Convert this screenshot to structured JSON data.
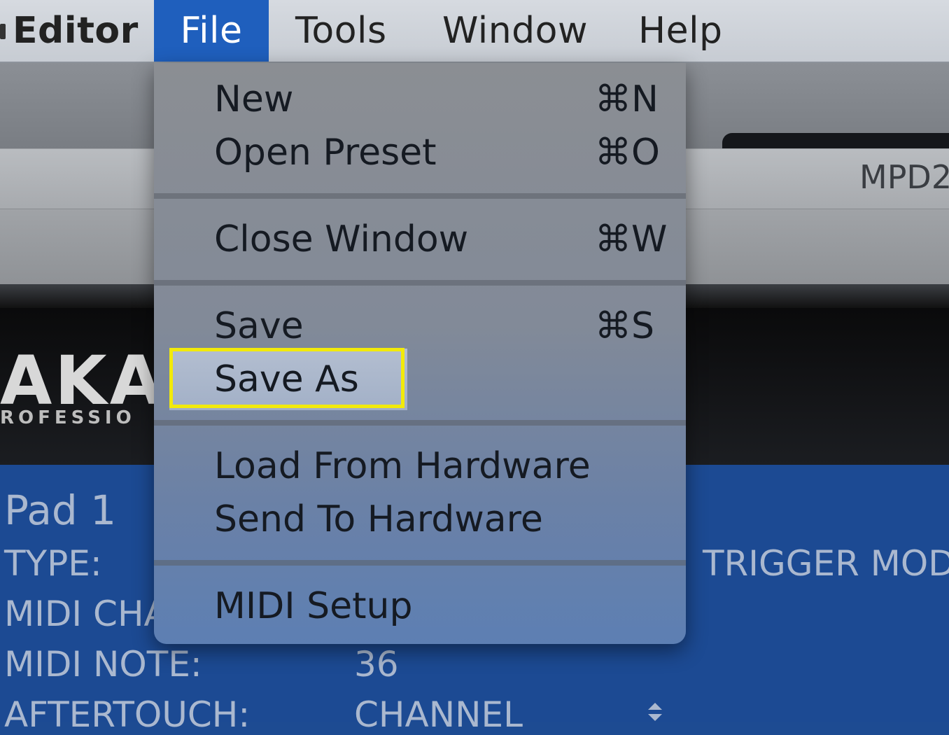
{
  "menubar": {
    "app": "Editor",
    "items": [
      "File",
      "Tools",
      "Window",
      "Help"
    ]
  },
  "background": {
    "model": "MPD2",
    "logo": "AKA",
    "logo_sub": "ROFESSIO"
  },
  "panel": {
    "pad_title": "Pad 1",
    "type_label": "TYPE:",
    "midi_channel_label": "MIDI CHA",
    "midi_note_label": "MIDI NOTE:",
    "midi_note_value": "36",
    "aftertouch_label": "AFTERTOUCH:",
    "aftertouch_value": "CHANNEL",
    "trigger_mode_label": "TRIGGER MODE:"
  },
  "file_menu": {
    "new": {
      "label": "New",
      "shortcut": "⌘N"
    },
    "open_preset": {
      "label": "Open Preset",
      "shortcut": "⌘O"
    },
    "close_window": {
      "label": "Close Window",
      "shortcut": "⌘W"
    },
    "save": {
      "label": "Save",
      "shortcut": "⌘S"
    },
    "save_as": {
      "label": "Save As"
    },
    "load_from_hardware": {
      "label": "Load From Hardware"
    },
    "send_to_hardware": {
      "label": "Send To Hardware"
    },
    "midi_setup": {
      "label": "MIDI Setup"
    }
  },
  "colors": {
    "highlight_border": "#f2ea0a",
    "menu_selected": "#1f5fbd",
    "panel_blue": "#1c4a93"
  }
}
